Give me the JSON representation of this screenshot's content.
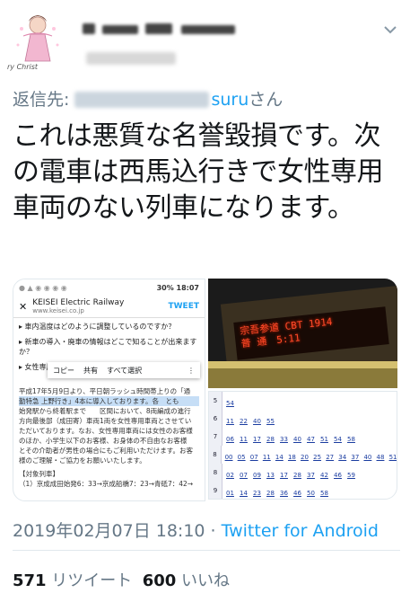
{
  "tweet": {
    "reply_prefix": "返信先: ",
    "reply_handle_suffix": "suru",
    "reply_suffix": "さん",
    "text": "これは悪質な名誉毀損です。次の電車は西馬込行きで女性専用車両のない列車になります。",
    "timestamp": "2019年02月07日 18:10",
    "separator": " · ",
    "via": "Twitter for Android",
    "retweet_count": "571",
    "retweet_label": " リツイート  ",
    "like_count": "600",
    "like_label": " いいね"
  },
  "avatar": {
    "caption": "ry Christ"
  },
  "phone": {
    "status_battery": "30%",
    "status_time": "18:07",
    "site_title": "KEISEI Electric Railway",
    "site_url": "www.keisei.co.jp",
    "tweet_button": "TWEET",
    "faq_items": [
      "▸ 車内温度はどのように調整しているのですか？",
      "▸ 新車の導入・廃車の情報はどこで知ることが出来ますか？",
      "▸ 女性専用車"
    ],
    "popup": {
      "copy": "コピー",
      "share": "共有",
      "select_all": "すべて選択"
    },
    "body_lines": [
      "平成17年5月9日より、平日朝ラッシュ時間帯上りの「通",
      "勤特急 上野行き」4本に導入しております。各　とも",
      "始発駅から終着駅まで　　区間において、8両編成の進行",
      "方向最後部（成田寄）車両1両を女性専用車両とさせてい",
      "ただいております。なお、女性専用車両には女性のお客様",
      "のほか、小学生以下のお客様、お身体の不自由なお客様",
      "とその介助者が男性の場合にもご利用いただけます。お客",
      "様のご理解・ご協力をお願いいたします。",
      "【対象列車】",
      "（1）京成成田始発6：33→京成船橋7：23→青砥7：42→"
    ]
  },
  "display": {
    "line1": "宗吾参道 CBT 1914",
    "line2": "普 通　5:11"
  },
  "timetable": {
    "rows": [
      {
        "hour": "5",
        "mins": [
          "54"
        ]
      },
      {
        "hour": "6",
        "mins": [
          "11",
          "22",
          "40",
          "55"
        ]
      },
      {
        "hour": "7",
        "mins": [
          "06",
          "11",
          "17",
          "28",
          "33",
          "40",
          "47",
          "51",
          "54",
          "58"
        ]
      },
      {
        "hour": "8",
        "mins": [
          "00",
          "05",
          "07",
          "11",
          "14",
          "18",
          "20",
          "25",
          "27",
          "34",
          "37",
          "40",
          "48",
          "51"
        ]
      },
      {
        "hour": "8",
        "mins": [
          "02",
          "07",
          "09",
          "13",
          "17",
          "28",
          "37",
          "42",
          "46",
          "59"
        ]
      },
      {
        "hour": "9",
        "mins": [
          "01",
          "14",
          "23",
          "28",
          "36",
          "46",
          "50",
          "58"
        ]
      }
    ]
  }
}
